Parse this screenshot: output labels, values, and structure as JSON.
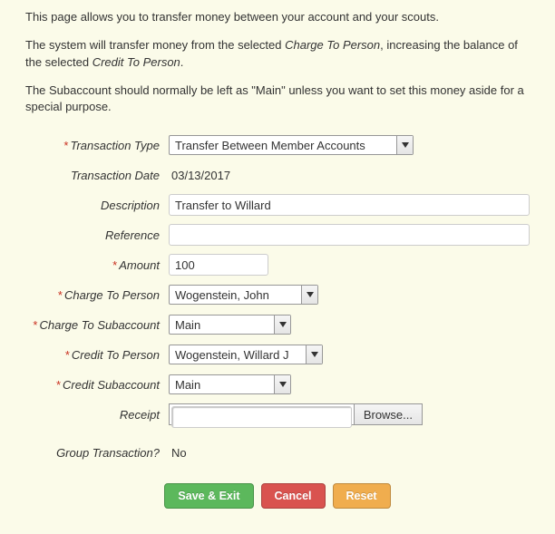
{
  "intro": {
    "p1_a": "This page allows you to transfer money between your account and your scouts.",
    "p2_a": "The system will transfer money from the selected ",
    "p2_em1": "Charge To Person",
    "p2_b": ", increasing the balance of the selected ",
    "p2_em2": "Credit To Person",
    "p2_c": ".",
    "p3_a": "The Subaccount should normally be left as \"Main\" unless you want to set this money aside for a special purpose."
  },
  "labels": {
    "transaction_type": "Transaction Type",
    "transaction_date": "Transaction Date",
    "description": "Description",
    "reference": "Reference",
    "amount": "Amount",
    "charge_to_person": "Charge To Person",
    "charge_to_subaccount": "Charge To Subaccount",
    "credit_to_person": "Credit To Person",
    "credit_subaccount": "Credit Subaccount",
    "receipt": "Receipt",
    "group_transaction": "Group Transaction?"
  },
  "values": {
    "transaction_type": "Transfer Between Member Accounts",
    "transaction_date": "03/13/2017",
    "description": "Transfer to Willard",
    "reference": "",
    "amount": "100",
    "charge_to_person": "Wogenstein, John",
    "charge_to_subaccount": "Main",
    "credit_to_person": "Wogenstein, Willard J",
    "credit_subaccount": "Main",
    "receipt_path": "",
    "browse": "Browse...",
    "group_transaction": "No"
  },
  "buttons": {
    "save": "Save & Exit",
    "cancel": "Cancel",
    "reset": "Reset"
  },
  "asterisk": "*"
}
